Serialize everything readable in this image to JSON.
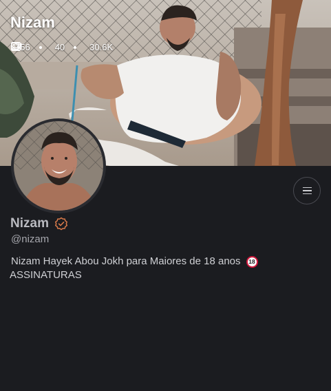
{
  "cover": {
    "title": "Nizam",
    "stats": {
      "photos": "156",
      "videos": "40",
      "likes": "30.6K"
    }
  },
  "profile": {
    "display_name": "Nizam",
    "handle": "@nizam",
    "bio_line1": "Nizam Hayek Abou Jokh para Maiores de 18 anos",
    "bio_badge": "18",
    "bio_line2": "ASSINATURAS",
    "verified": true
  },
  "colors": {
    "background": "#1b1c20",
    "verified_badge": "#d97a4a",
    "adult_badge": "#d0193d"
  },
  "icons": [
    "image-icon",
    "video-icon",
    "heart-icon",
    "menu-icon",
    "verified-icon"
  ]
}
